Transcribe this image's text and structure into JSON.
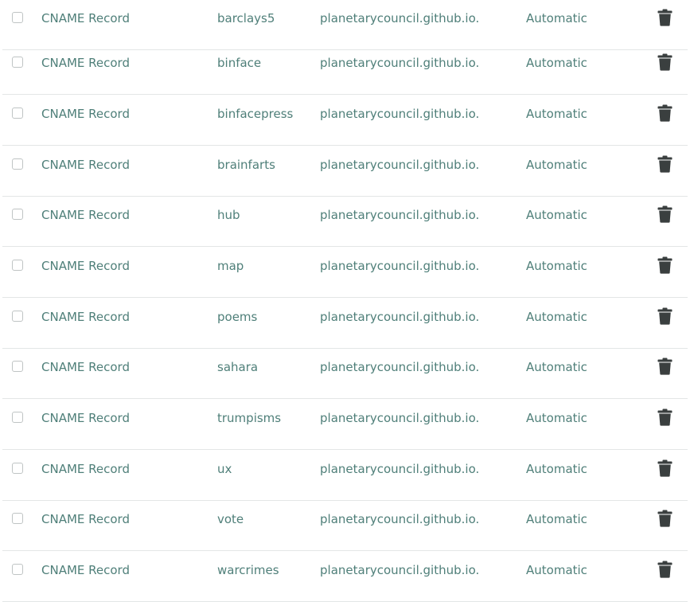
{
  "records": [
    {
      "type": "CNAME Record",
      "name": "barclays5",
      "content": "planetarycouncil.github.io.",
      "ttl": "Automatic",
      "delete_icon": "trash-icon"
    },
    {
      "type": "CNAME Record",
      "name": "binface",
      "content": "planetarycouncil.github.io.",
      "ttl": "Automatic",
      "delete_icon": "trash-icon"
    },
    {
      "type": "CNAME Record",
      "name": "binfacepress",
      "content": "planetarycouncil.github.io.",
      "ttl": "Automatic",
      "delete_icon": "trash-icon"
    },
    {
      "type": "CNAME Record",
      "name": "brainfarts",
      "content": "planetarycouncil.github.io.",
      "ttl": "Automatic",
      "delete_icon": "trash-icon"
    },
    {
      "type": "CNAME Record",
      "name": "hub",
      "content": "planetarycouncil.github.io.",
      "ttl": "Automatic",
      "delete_icon": "trash-icon"
    },
    {
      "type": "CNAME Record",
      "name": "map",
      "content": "planetarycouncil.github.io.",
      "ttl": "Automatic",
      "delete_icon": "trash-icon"
    },
    {
      "type": "CNAME Record",
      "name": "poems",
      "content": "planetarycouncil.github.io.",
      "ttl": "Automatic",
      "delete_icon": "trash-icon"
    },
    {
      "type": "CNAME Record",
      "name": "sahara",
      "content": "planetarycouncil.github.io.",
      "ttl": "Automatic",
      "delete_icon": "trash-icon"
    },
    {
      "type": "CNAME Record",
      "name": "trumpisms",
      "content": "planetarycouncil.github.io.",
      "ttl": "Automatic",
      "delete_icon": "trash-icon"
    },
    {
      "type": "CNAME Record",
      "name": "ux",
      "content": "planetarycouncil.github.io.",
      "ttl": "Automatic",
      "delete_icon": "trash-icon"
    },
    {
      "type": "CNAME Record",
      "name": "vote",
      "content": "planetarycouncil.github.io.",
      "ttl": "Automatic",
      "delete_icon": "trash-icon"
    },
    {
      "type": "CNAME Record",
      "name": "warcrimes",
      "content": "planetarycouncil.github.io.",
      "ttl": "Automatic",
      "delete_icon": "trash-icon"
    }
  ],
  "colors": {
    "text": "#4f7f79",
    "divider": "#e3e6e6",
    "checkbox_border": "#bfc4c4",
    "icon": "#3a3f3f"
  }
}
